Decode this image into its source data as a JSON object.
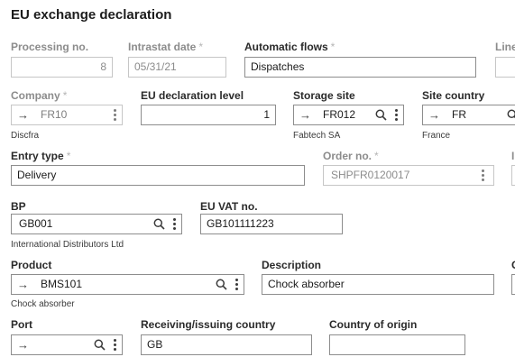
{
  "page": {
    "title": "EU exchange declaration"
  },
  "fields": {
    "processing_no": {
      "label": "Processing no.",
      "value": "8"
    },
    "intrastat_date": {
      "label": "Intrastat date",
      "value": "05/31/21"
    },
    "automatic_flows": {
      "label": "Automatic flows",
      "value": "Dispatches"
    },
    "line": {
      "label": "Line"
    },
    "company": {
      "label": "Company",
      "value": "FR10",
      "sub": "Discfra"
    },
    "eu_declaration_level": {
      "label": "EU declaration level",
      "value": "1"
    },
    "storage_site": {
      "label": "Storage site",
      "value": "FR012",
      "sub": "Fabtech SA"
    },
    "site_country": {
      "label": "Site country",
      "value": "FR",
      "sub": "France"
    },
    "entry_type": {
      "label": "Entry type",
      "value": "Delivery"
    },
    "order_no": {
      "label": "Order no.",
      "value": "SHPFR0120017"
    },
    "bp": {
      "label": "BP",
      "value": "GB001",
      "sub": "International Distributors Ltd"
    },
    "eu_vat_no": {
      "label": "EU VAT no.",
      "value": "GB101111223"
    },
    "product": {
      "label": "Product",
      "value": "BMS101",
      "sub": "Chock absorber"
    },
    "description": {
      "label": "Description",
      "value": "Chock absorber"
    },
    "port": {
      "label": "Port",
      "value": ""
    },
    "receiving_issuing_country": {
      "label": "Receiving/issuing country",
      "value": "GB"
    },
    "country_of_origin": {
      "label": "Country of origin",
      "value": ""
    }
  },
  "required_marker": "*",
  "icons": {
    "arrow": "→",
    "search": "search-icon",
    "menu": "more-vertical-icon"
  }
}
